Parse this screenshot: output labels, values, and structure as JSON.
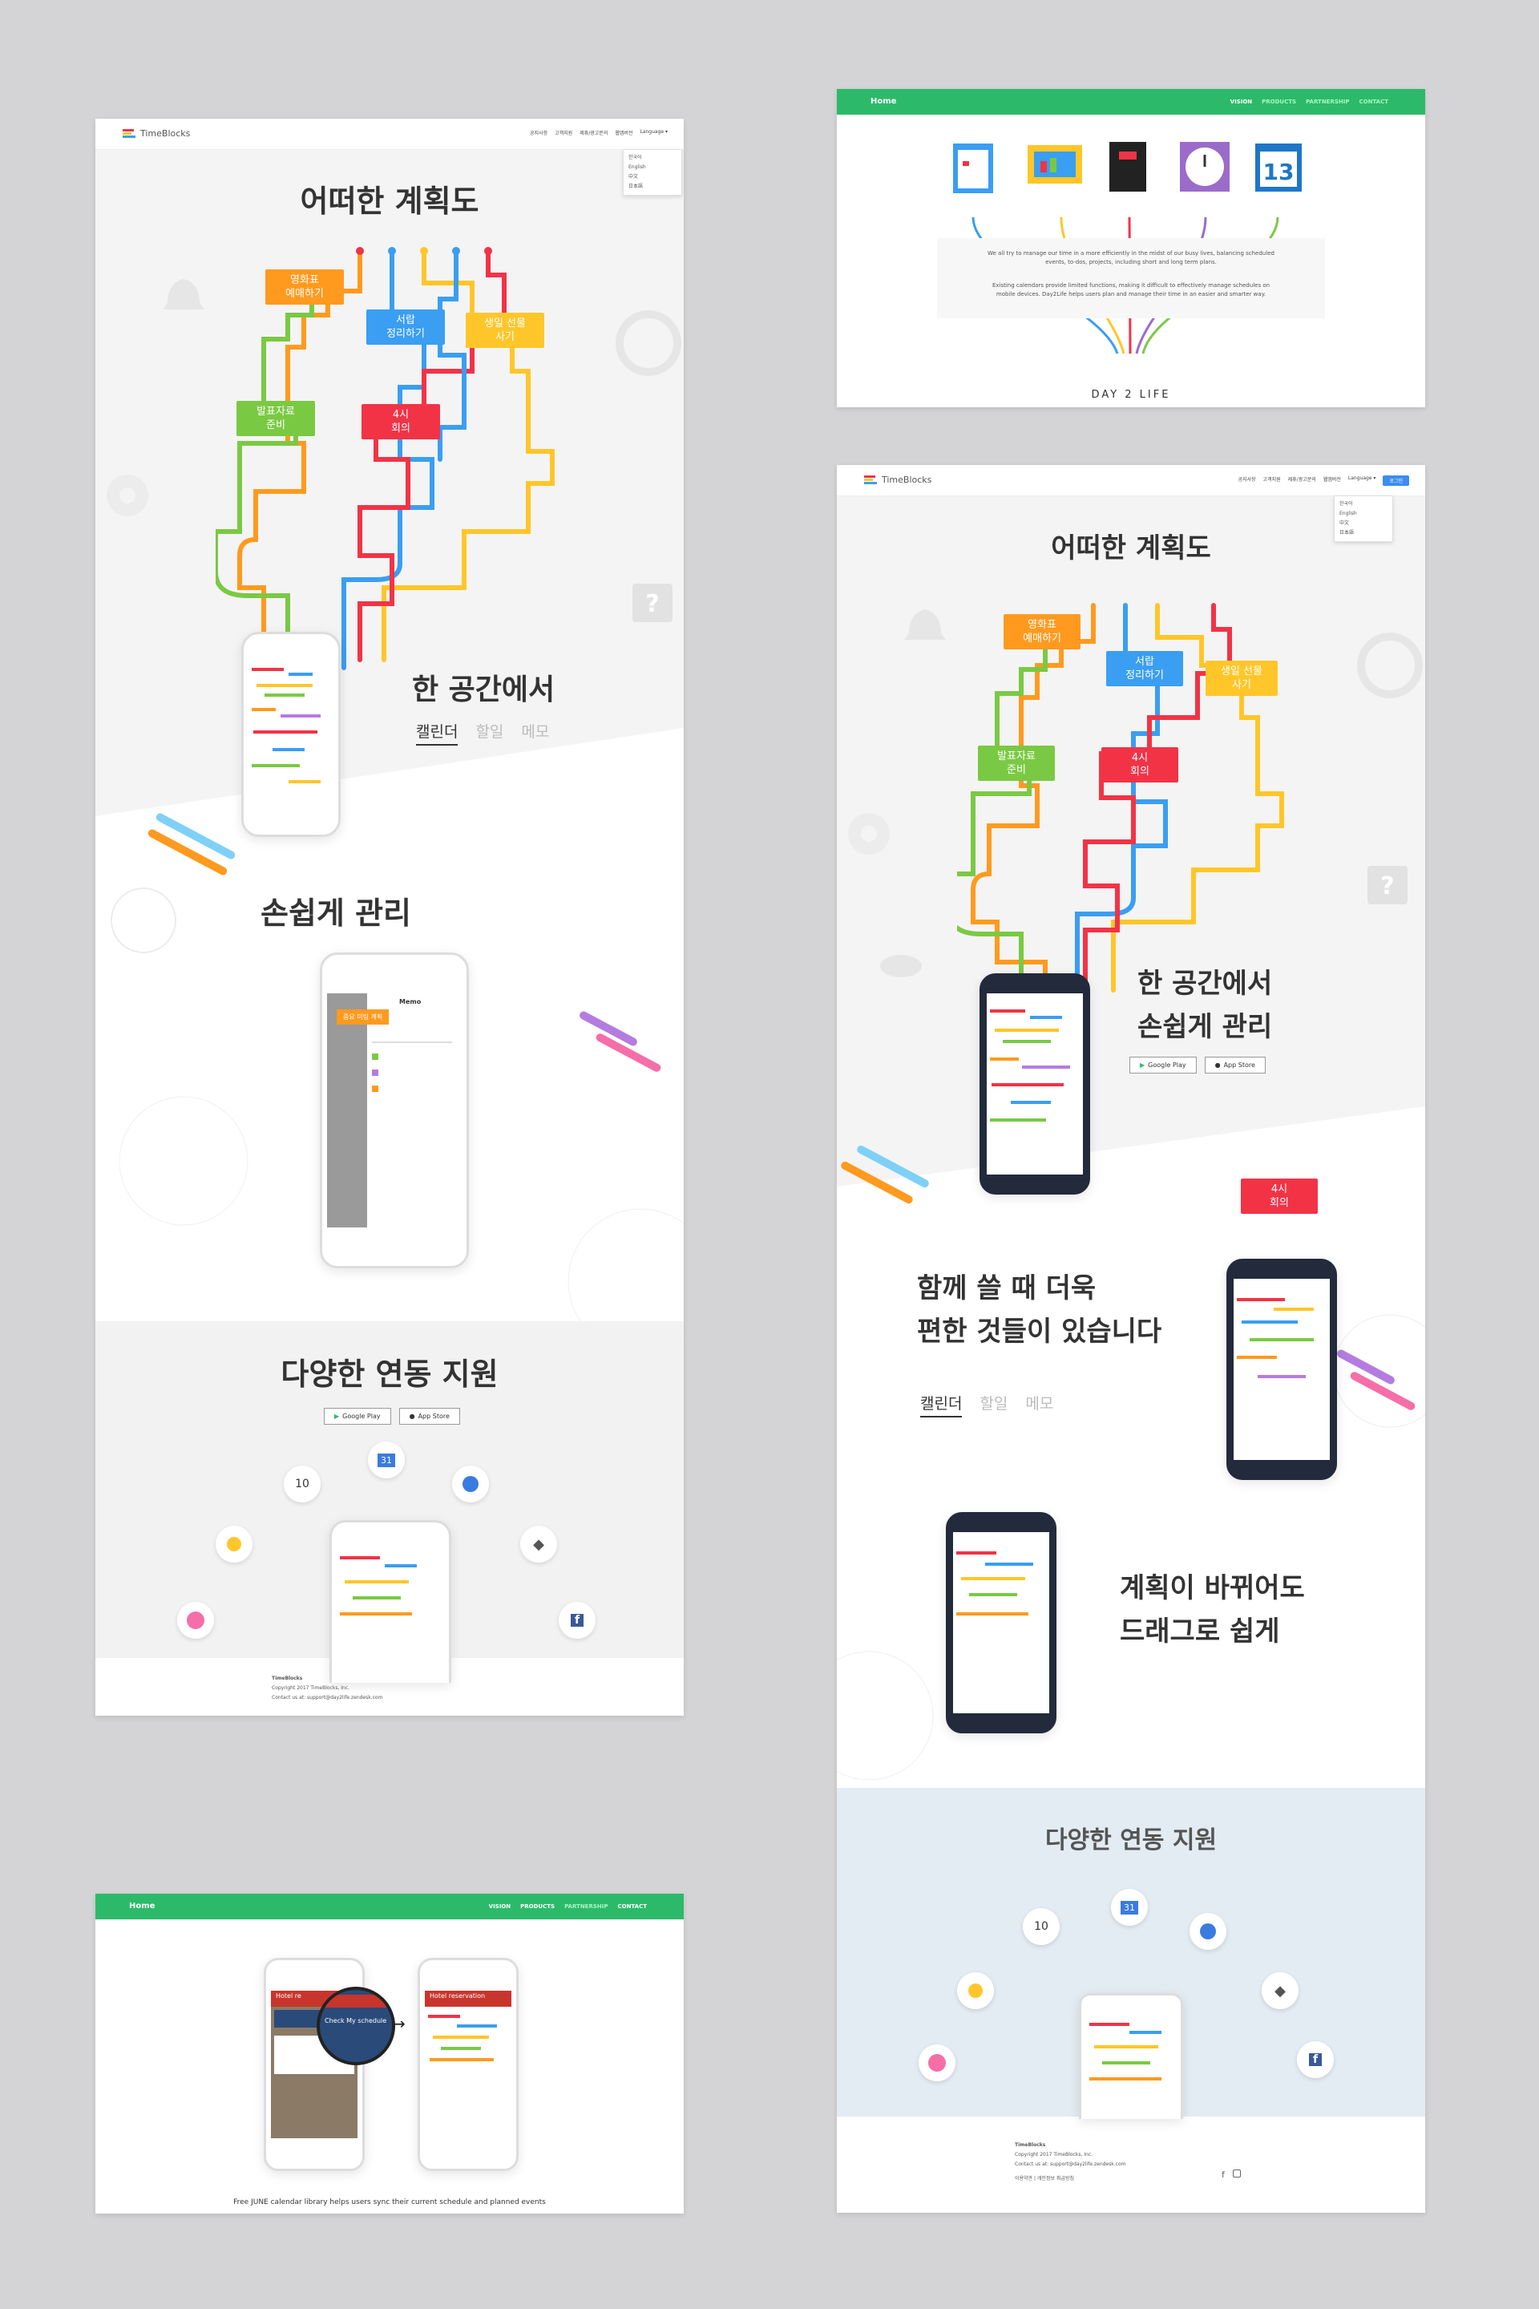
{
  "desktop_a": {
    "logo_text": "TimeBlocks",
    "nav": [
      "공지사항",
      "고객지원",
      "제휴/광고문의",
      "웹앱버전"
    ],
    "language": "Language",
    "languages": [
      "한국어",
      "English",
      "中文",
      "日本語"
    ],
    "hero_title": "어떠한 계획도",
    "tags": [
      "영화표\n예매하기",
      "서랍\n정리하기",
      "생일 선물\n사기",
      "발표자료\n준비",
      "4시\n회의"
    ],
    "section1_title": "한 공간에서",
    "tabs": [
      "캘린더",
      "할일",
      "메모"
    ],
    "section2_title": "손쉽게 관리",
    "memo_header": "Memo",
    "memo_tag": "중요 미팅 계획",
    "section3_title": "다양한 연동 지원",
    "google_play": "Google Play",
    "app_store": "App Store",
    "icon_dates": [
      "10",
      "31"
    ],
    "footer_brand": "TimeBlocks",
    "footer_copy": "Copyright 2017 TimeBlocks, Inc.",
    "footer_contact": "Contact us at: support@day2life.zendesk.com"
  },
  "desktop_b": {
    "home": "Home",
    "nav": [
      "VISION",
      "PRODUCTS",
      "PARTNERSHIP",
      "CONTACT"
    ],
    "active_nav": "VISION",
    "calendar_day": "13",
    "para1": "We all try to manage our time in a more efficiently in the midst of our busy lives, balancing scheduled events, to-dos, projects, including short and long term plans.",
    "para2": "Existing calendars provide limited functions, making it difficult to effectively manage schedules on mobile devices. Day2Life helps users plan and manage their time in an easier and smarter way.",
    "brand": "DAY 2 LIFE"
  },
  "desktop_c": {
    "logo_text": "TimeBlocks",
    "nav": [
      "공지사항",
      "고객지원",
      "제휴/광고문의",
      "웹앱버전"
    ],
    "language": "Language",
    "login": "로그인",
    "languages": [
      "한국어",
      "English",
      "中文",
      "日本語"
    ],
    "hero_title": "어떠한 계획도",
    "tags": [
      "영화표\n예매하기",
      "서랍\n정리하기",
      "생일 선물\n사기",
      "발표자료\n준비",
      "4시\n회의"
    ],
    "sec1_line1": "한 공간에서",
    "sec1_line2": "손쉽게 관리",
    "google_play": "Google Play",
    "app_store": "App Store",
    "meeting_tag": "4시\n회의",
    "sec2_line1": "함께 쓸 때 더욱",
    "sec2_line2": "편한 것들이 있습니다",
    "tabs": [
      "캘린더",
      "할일",
      "메모"
    ],
    "sec3_line1": "계획이 바뀌어도",
    "sec3_line2": "드래그로 쉽게",
    "sec4_title": "다양한 연동 지원",
    "icon_dates": [
      "10",
      "31"
    ],
    "footer_brand": "TimeBlocks",
    "footer_copy": "Copyright 2017 TimeBlocks, Inc.",
    "footer_contact": "Contact us at: support@day2life.zendesk.com",
    "footer_links": "이용약관 | 개인정보 취급방침"
  },
  "desktop_d": {
    "home": "Home",
    "nav": [
      "VISION",
      "PRODUCTS",
      "PARTNERSHIP",
      "CONTACT"
    ],
    "active_nav": "PARTNERSHIP",
    "app_header_left": "Hotel re",
    "check_label": "Check My schedule",
    "app_header_right": "Hotel reservation",
    "caption": "Free JUNE calendar library helps users sync their current schedule and planned events"
  },
  "colors": {
    "orange": "#ff9a1f",
    "blue": "#3a9ef2",
    "yellow": "#ffc62a",
    "green": "#7ac943",
    "red": "#f23346",
    "brand_green": "#2cba6a",
    "light_blue_bg": "#e3ebf3"
  }
}
